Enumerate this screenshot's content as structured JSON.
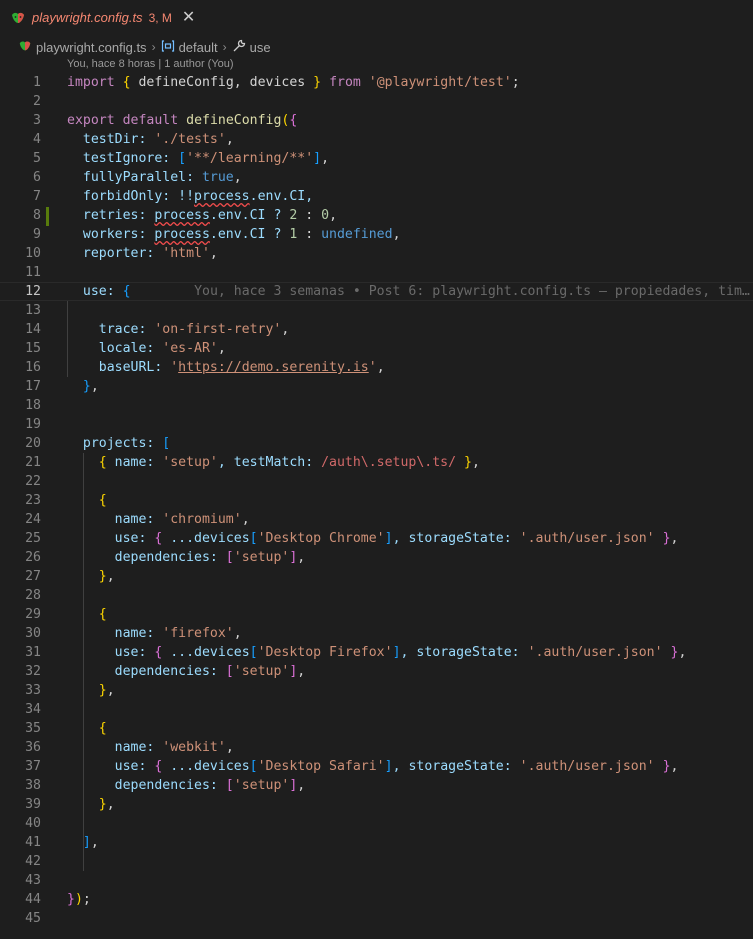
{
  "tab": {
    "title": "playwright.config.ts",
    "status": "3, M",
    "close_glyph": "✕",
    "icon": "playwright-icon"
  },
  "breadcrumb": {
    "file": "playwright.config.ts",
    "symbol1": "default",
    "symbol2": "use",
    "sep": "›"
  },
  "codelens": "You, hace 8 horas | 1 author (You)",
  "inline_blame": "You, hace 3 semanas • Post 6: playwright.config.ts — propiedades, tim…",
  "line_numbers": [
    "1",
    "2",
    "3",
    "4",
    "5",
    "6",
    "7",
    "8",
    "9",
    "10",
    "11",
    "12",
    "13",
    "14",
    "15",
    "16",
    "17",
    "18",
    "19",
    "20",
    "21",
    "22",
    "23",
    "24",
    "25",
    "26",
    "27",
    "28",
    "29",
    "30",
    "31",
    "32",
    "33",
    "34",
    "35",
    "36",
    "37",
    "38",
    "39",
    "40",
    "41",
    "42",
    "43",
    "44",
    "45"
  ],
  "code": {
    "l1": [
      "import",
      " ",
      "{",
      " defineConfig, devices ",
      "}",
      " ",
      "from",
      " ",
      "'@playwright/test'",
      ";"
    ],
    "l3": [
      "export",
      " ",
      "default",
      " ",
      "defineConfig",
      "(",
      "{"
    ],
    "l4": [
      "  testDir: ",
      "'./tests'",
      ","
    ],
    "l5": [
      "  testIgnore: ",
      "[",
      "'**/learning/**'",
      "]",
      ","
    ],
    "l6": [
      "  fullyParallel: ",
      "true",
      ","
    ],
    "l7": [
      "  forbidOnly: !!",
      "process",
      ".env.CI,"
    ],
    "l8": [
      "  retries: ",
      "process",
      ".env.CI ? ",
      "2",
      " : ",
      "0",
      ","
    ],
    "l9": [
      "  workers: ",
      "process",
      ".env.CI ? ",
      "1",
      " : ",
      "undefined",
      ","
    ],
    "l10": [
      "  reporter: ",
      "'html'",
      ","
    ],
    "l12": [
      "  use: ",
      "{"
    ],
    "l14": [
      "    trace: ",
      "'on-first-retry'",
      ","
    ],
    "l15": [
      "    locale: ",
      "'es-AR'",
      ","
    ],
    "l16": [
      "    baseURL: ",
      "'",
      "https://demo.serenity.is",
      "'",
      ","
    ],
    "l17": [
      "  ",
      "}",
      ","
    ],
    "l20": [
      "  projects: ",
      "["
    ],
    "l21": [
      "    ",
      "{",
      " name: ",
      "'setup'",
      ", testMatch: ",
      "/auth\\.setup\\.ts/",
      " ",
      "}",
      ","
    ],
    "l23": [
      "    ",
      "{"
    ],
    "l24": [
      "      name: ",
      "'chromium'",
      ","
    ],
    "l25": [
      "      use: ",
      "{",
      " ...devices",
      "[",
      "'Desktop Chrome'",
      "]",
      ", storageState: ",
      "'.auth/user.json'",
      " ",
      "}",
      ","
    ],
    "l26": [
      "      dependencies: ",
      "[",
      "'setup'",
      "]",
      ","
    ],
    "l27": [
      "    ",
      "}",
      ","
    ],
    "l29": [
      "    ",
      "{"
    ],
    "l30": [
      "      name: ",
      "'firefox'",
      ","
    ],
    "l31": [
      "      use: ",
      "{",
      " ...devices",
      "[",
      "'Desktop Firefox'",
      "]",
      ", storageState: ",
      "'.auth/user.json'",
      " ",
      "}",
      ","
    ],
    "l32": [
      "      dependencies: ",
      "[",
      "'setup'",
      "]",
      ","
    ],
    "l33": [
      "    ",
      "}",
      ","
    ],
    "l35": [
      "    ",
      "{"
    ],
    "l36": [
      "      name: ",
      "'webkit'",
      ","
    ],
    "l37": [
      "      use: ",
      "{",
      " ...devices",
      "[",
      "'Desktop Safari'",
      "]",
      ", storageState: ",
      "'.auth/user.json'",
      " ",
      "}",
      ","
    ],
    "l38": [
      "      dependencies: ",
      "[",
      "'setup'",
      "]",
      ","
    ],
    "l39": [
      "    ",
      "}",
      ","
    ],
    "l41": [
      "  ",
      "]",
      ","
    ],
    "l44": [
      "}",
      ")",
      ";"
    ]
  },
  "colors": {
    "background": "#1e1e1e",
    "keyword": "#569cd6",
    "control_keyword": "#c586c0",
    "string": "#ce9178",
    "function": "#dcdcaa",
    "number": "#b5cea8",
    "regex": "#d16969",
    "git_modified": "#587c0c",
    "tab_modified": "#f48771"
  }
}
